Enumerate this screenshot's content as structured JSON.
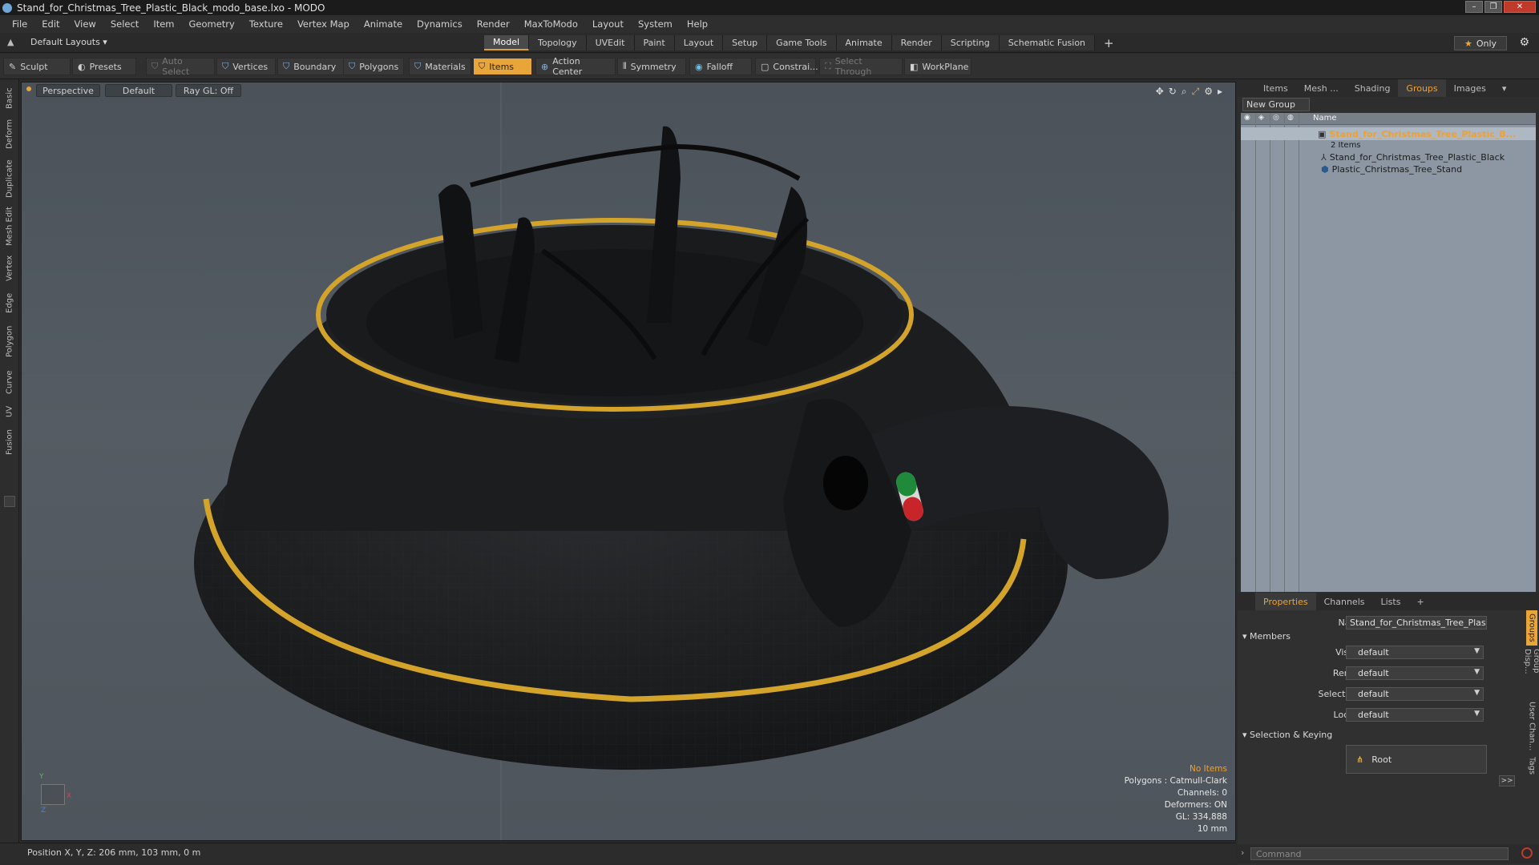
{
  "window": {
    "title": "Stand_for_Christmas_Tree_Plastic_Black_modo_base.lxo - MODO",
    "minimize": "–",
    "maximize": "❐",
    "close": "✕"
  },
  "menu": [
    "File",
    "Edit",
    "View",
    "Select",
    "Item",
    "Geometry",
    "Texture",
    "Vertex Map",
    "Animate",
    "Dynamics",
    "Render",
    "MaxToModo",
    "Layout",
    "System",
    "Help"
  ],
  "layout": {
    "selector": "Default Layouts ▾",
    "tabs": [
      "Model",
      "Topology",
      "UVEdit",
      "Paint",
      "Layout",
      "Setup",
      "Game Tools",
      "Animate",
      "Render",
      "Scripting",
      "Schematic Fusion"
    ],
    "active_tab": "Model",
    "add": "+",
    "only_label": "Only",
    "gear": "⚙"
  },
  "toolbar": {
    "sculpt": "Sculpt",
    "presets": "Presets",
    "auto_select": "Auto Select",
    "vertices": "Vertices",
    "boundary": "Boundary",
    "polygons": "Polygons",
    "materials": "Materials",
    "items": "Items",
    "action_center": "Action Center",
    "symmetry": "Symmetry",
    "falloff": "Falloff",
    "constraints": "Constrai...",
    "select_through": "Select Through",
    "workplane": "WorkPlane"
  },
  "left_tabs": [
    "Basic",
    "Deform",
    "Duplicate",
    "Mesh Edit",
    "Vertex",
    "Edge",
    "Polygon",
    "Curve",
    "UV",
    "Fusion"
  ],
  "viewport": {
    "view": "Perspective",
    "shading": "Default",
    "raygl": "Ray GL: Off",
    "stats": {
      "no_items": "No Items",
      "polygons": "Polygons : Catmull-Clark",
      "channels": "Channels: 0",
      "deformers": "Deformers: ON",
      "gl": "GL: 334,888",
      "scale": "10 mm"
    },
    "axis_y": "Y",
    "axis_x": "X",
    "axis_z": "Z"
  },
  "status": {
    "position": "Position X, Y, Z:  206 mm, 103 mm, 0 m"
  },
  "right_panel": {
    "tabs": [
      "Items",
      "Mesh ...",
      "Shading",
      "Groups",
      "Images"
    ],
    "active_tab": "Groups",
    "new_group": "New Group",
    "column_name": "Name",
    "tree": [
      {
        "label": "Stand_for_Christmas_Tree_Plastic_B...",
        "type": "group"
      },
      {
        "label": "2 Items",
        "type": "count"
      },
      {
        "label": "Stand_for_Christmas_Tree_Plastic_Black",
        "type": "locator"
      },
      {
        "label": "Plastic_Christmas_Tree_Stand",
        "type": "mesh"
      }
    ]
  },
  "properties": {
    "tabs": [
      "Properties",
      "Channels",
      "Lists"
    ],
    "active_tab": "Properties",
    "add": "+",
    "name_label": "Name",
    "name_value": "Stand_for_Christmas_Tree_Plastic_Black (",
    "members": "Members",
    "visible_label": "Visible",
    "visible_value": "default",
    "render_label": "Render",
    "render_value": "default",
    "selectable_label": "Selectable",
    "selectable_value": "default",
    "locked_label": "Locked",
    "locked_value": "default",
    "selection_keying": "Selection & Keying",
    "root": "Root",
    "more": ">>",
    "side_tabs": [
      "Groups",
      "Group Disp...",
      "User Chan...",
      "Tags"
    ]
  },
  "command": {
    "placeholder": "Command"
  },
  "colors": {
    "accent": "#e8a53a",
    "group_text": "#f0a030",
    "stand_body": "#1e1f21",
    "gold_ring": "#d4a32a"
  }
}
